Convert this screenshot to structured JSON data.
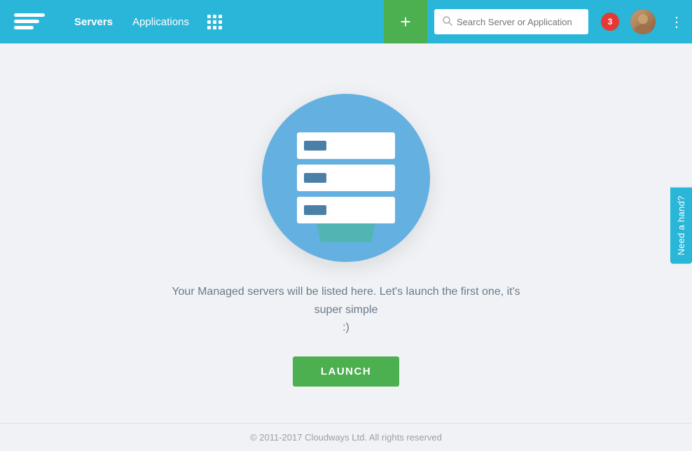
{
  "header": {
    "logo_alt": "Cloudways logo",
    "nav": {
      "servers_label": "Servers",
      "applications_label": "Applications"
    },
    "add_btn_label": "+",
    "search": {
      "placeholder": "Search Server or Application"
    },
    "notification_count": "3",
    "more_menu_label": "⋮"
  },
  "main": {
    "description_line1": "Your Managed servers will be listed here. Let's launch the first one, it's super simple",
    "description_line2": ":)",
    "launch_btn_label": "LAUNCH"
  },
  "footer": {
    "copyright": "© 2011-2017 Cloudways Ltd. All rights reserved"
  },
  "sidebar_help": {
    "label": "Need a hand?"
  }
}
